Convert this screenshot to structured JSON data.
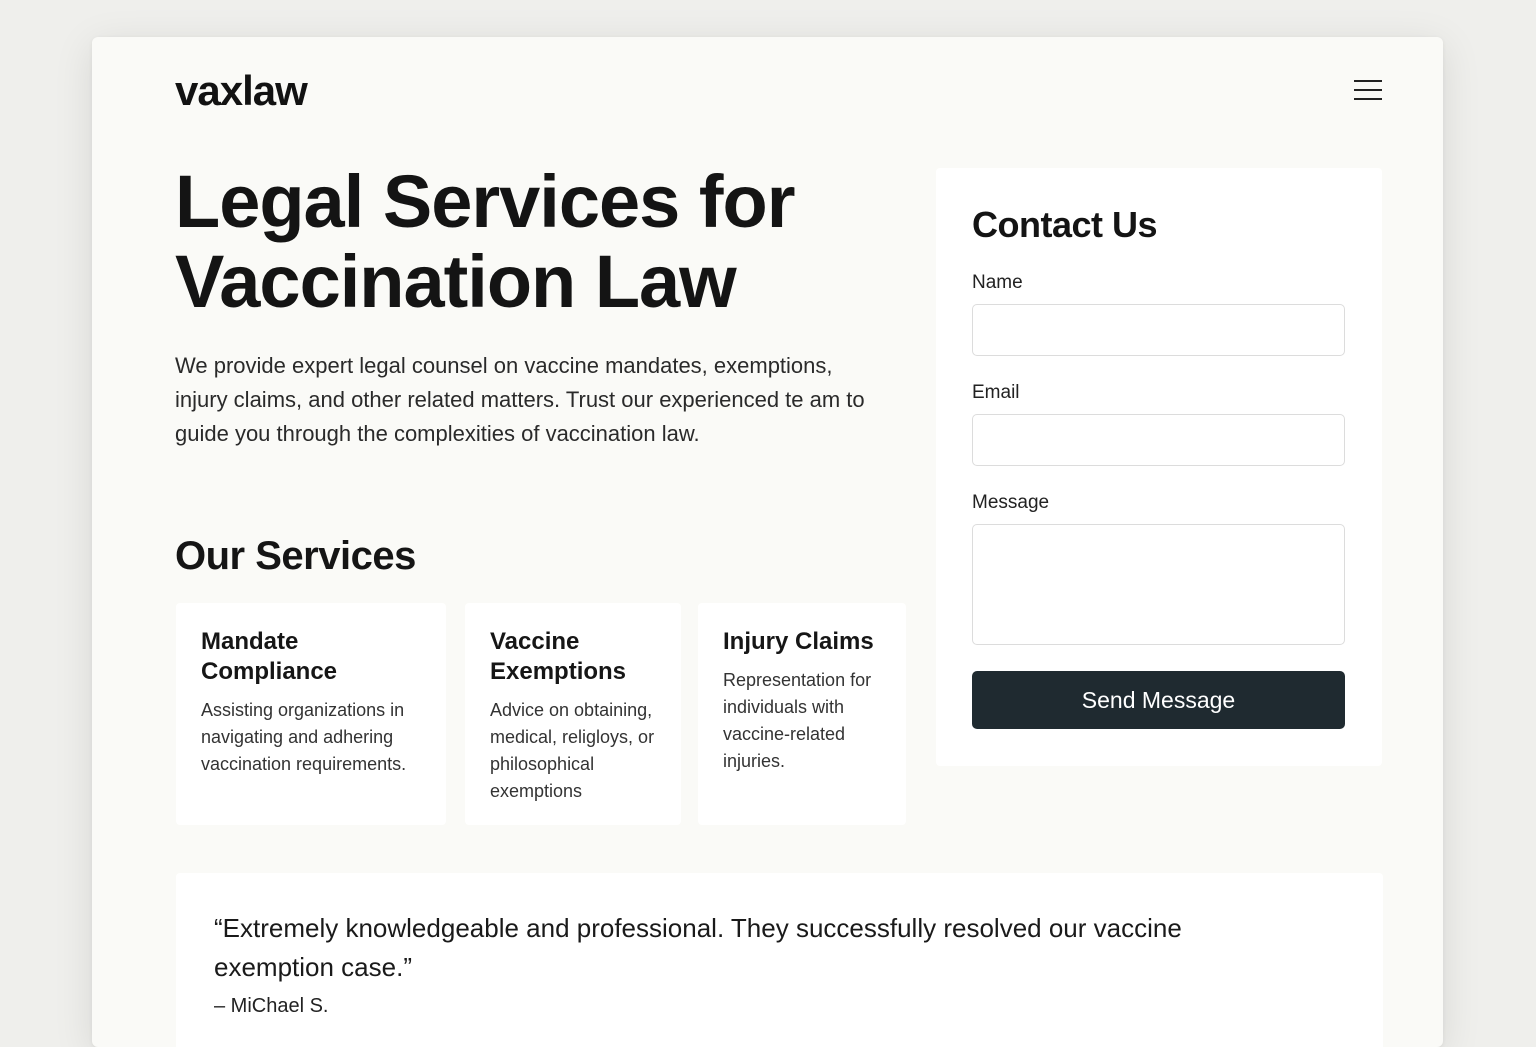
{
  "header": {
    "logo": "vaxlaw",
    "menu_icon": "hamburger-menu-icon"
  },
  "hero": {
    "title": "Legal Services for Vaccination Law",
    "description": "We provide expert legal counsel on vaccine mandates, exemptions, injury claims, and other related matters. Trust our experienced te am to guide you through the complexities of vaccination law."
  },
  "services": {
    "heading": "Our Services",
    "items": [
      {
        "title": "Mandate Compliance",
        "description": "Assisting organizations in navigating and adhering vaccination requirements."
      },
      {
        "title": "Vaccine Exemptions",
        "description": "Advice on obtaining, medical, religloys, or philosophical exemptions"
      },
      {
        "title": "Injury Claims",
        "description": "Representation for individuals with vaccine-related injuries."
      }
    ]
  },
  "contact": {
    "heading": "Contact Us",
    "name_label": "Name",
    "email_label": "Email",
    "message_label": "Message",
    "submit_label": "Send Message"
  },
  "testimonial": {
    "quote": "“Extremely knowledgeable and professional. They successfully resolved our vaccine exemption case.”",
    "author": "– MiChael S."
  },
  "colors": {
    "background": "#efefec",
    "page": "#fafaf7",
    "button": "#1f2a30"
  }
}
